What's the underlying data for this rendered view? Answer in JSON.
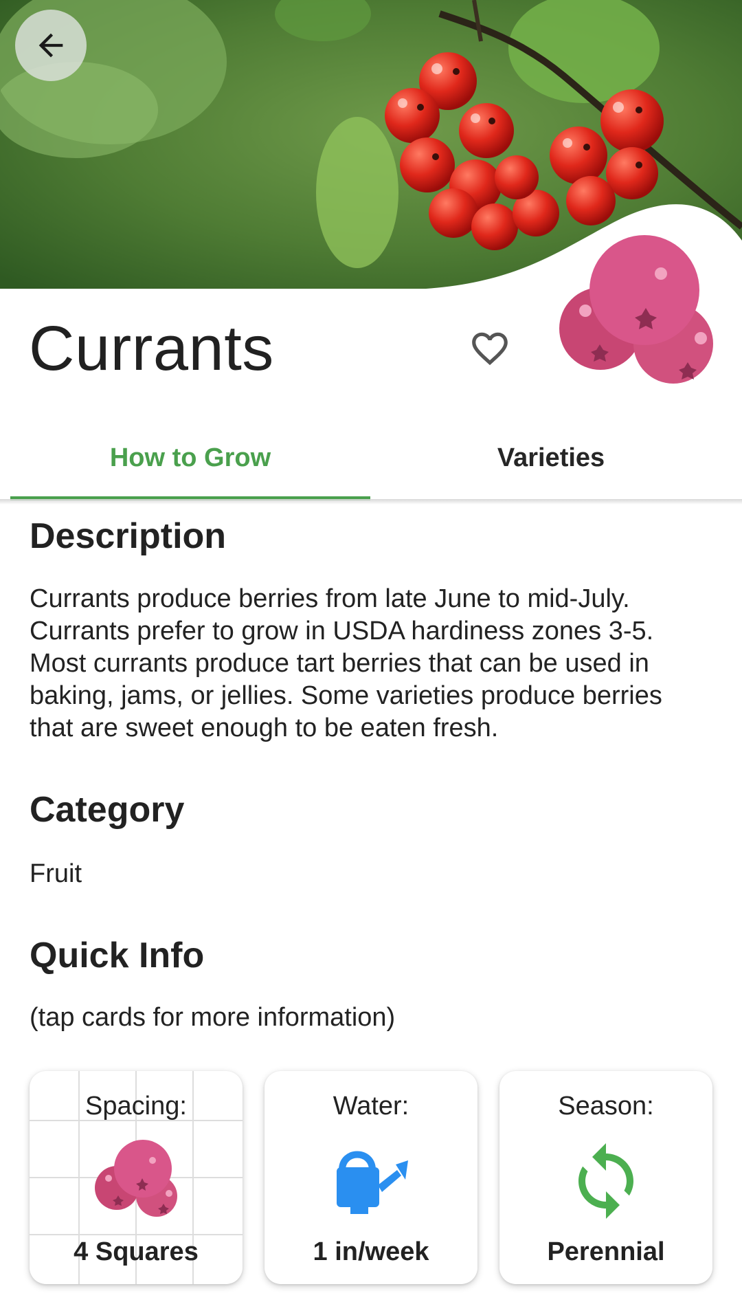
{
  "header": {
    "title": "Currants",
    "back_label": "Back",
    "favorite_label": "Favorite"
  },
  "tabs": [
    {
      "label": "How to Grow",
      "active": true
    },
    {
      "label": "Varieties",
      "active": false
    }
  ],
  "colors": {
    "accent": "#4aa04d",
    "berry": "#d64f7f",
    "water_icon": "#2a8ff0",
    "season_icon": "#4caf50"
  },
  "description": {
    "title": "Description",
    "lines": [
      "Currants produce berries from late June to mid-July.",
      "Currants prefer to grow in USDA hardiness zones 3-5.",
      "Most currants produce tart berries that can be used in",
      "baking, jams, or jellies. Some varieties produce berries",
      "that are sweet enough to be eaten fresh."
    ]
  },
  "category": {
    "title": "Category",
    "value": "Fruit"
  },
  "quick_info": {
    "title": "Quick Info",
    "hint": "(tap cards for more information)",
    "cards": [
      {
        "label": "Spacing:",
        "value": "4 Squares",
        "icon": "currant-berries-icon"
      },
      {
        "label": "Water:",
        "value": "1 in/week",
        "icon": "watering-can-icon"
      },
      {
        "label": "Season:",
        "value": "Perennial",
        "icon": "cycle-arrows-icon"
      }
    ]
  }
}
